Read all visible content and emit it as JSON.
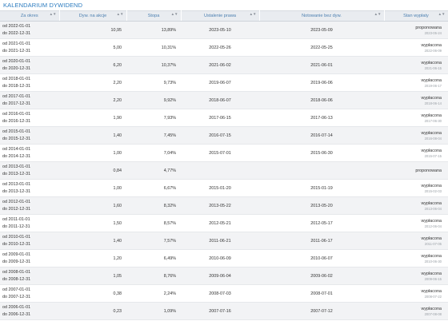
{
  "title": "KALENDARIUM DYWIDEND",
  "columns": [
    {
      "label": "Za okres"
    },
    {
      "label": "Dyw. na akcje"
    },
    {
      "label": "Stopa"
    },
    {
      "label": "Ustalenie prawa"
    },
    {
      "label": "Notowanie bez dyw."
    },
    {
      "label": "Stan wypłaty"
    }
  ],
  "sort_glyph": "▲▼",
  "rows": [
    {
      "from": "od 2022-01-01",
      "to": "do 2022-12-31",
      "dividend": "10,95",
      "yield": "13,89%",
      "record": "2023-05-10",
      "exdiv": "2023-05-09",
      "status": "proponowana",
      "status_date": "2023-05-24"
    },
    {
      "from": "od 2021-01-01",
      "to": "do 2021-12-31",
      "dividend": "5,00",
      "yield": "10,31%",
      "record": "2022-05-26",
      "exdiv": "2022-05-25",
      "status": "wypłacona",
      "status_date": "2022-06-09"
    },
    {
      "from": "od 2020-01-01",
      "to": "do 2020-12-31",
      "dividend": "6,20",
      "yield": "10,37%",
      "record": "2021-06-02",
      "exdiv": "2021-06-01",
      "status": "wypłacona",
      "status_date": "2021-06-15"
    },
    {
      "from": "od 2018-01-01",
      "to": "do 2018-12-31",
      "dividend": "2,20",
      "yield": "9,73%",
      "record": "2019-06-07",
      "exdiv": "2019-06-06",
      "status": "wypłacona",
      "status_date": "2019-06-17"
    },
    {
      "from": "od 2017-01-01",
      "to": "do 2017-12-31",
      "dividend": "2,20",
      "yield": "9,92%",
      "record": "2018-06-07",
      "exdiv": "2018-06-06",
      "status": "wypłacona",
      "status_date": "2018-06-14"
    },
    {
      "from": "od 2016-01-01",
      "to": "do 2016-12-31",
      "dividend": "1,90",
      "yield": "7,93%",
      "record": "2017-06-15",
      "exdiv": "2017-06-13",
      "status": "wypłacona",
      "status_date": "2017-06-30"
    },
    {
      "from": "od 2015-01-01",
      "to": "do 2015-12-31",
      "dividend": "1,40",
      "yield": "7,45%",
      "record": "2016-07-15",
      "exdiv": "2016-07-14",
      "status": "wypłacona",
      "status_date": "2016-08-04"
    },
    {
      "from": "od 2014-01-01",
      "to": "do 2014-12-31",
      "dividend": "1,00",
      "yield": "7,04%",
      "record": "2015-07-01",
      "exdiv": "2015-06-30",
      "status": "wypłacona",
      "status_date": "2015-07-15"
    },
    {
      "from": "od 2013-01-01",
      "to": "do 2013-12-31",
      "dividend": "0,84",
      "yield": "4,77%",
      "record": "",
      "exdiv": "",
      "status": "proponowana",
      "status_date": ""
    },
    {
      "from": "od 2013-01-01",
      "to": "do 2013-12-31",
      "dividend": "1,00",
      "yield": "6,67%",
      "record": "2015-01-20",
      "exdiv": "2015-01-19",
      "status": "wypłacona",
      "status_date": "2015-02-03"
    },
    {
      "from": "od 2012-01-01",
      "to": "do 2012-12-31",
      "dividend": "1,60",
      "yield": "8,32%",
      "record": "2013-05-22",
      "exdiv": "2013-05-20",
      "status": "wypłacona",
      "status_date": "2013-06-04"
    },
    {
      "from": "od 2011-01-01",
      "to": "do 2011-12-31",
      "dividend": "1,50",
      "yield": "8,57%",
      "record": "2012-05-21",
      "exdiv": "2012-05-17",
      "status": "wypłacona",
      "status_date": "2012-06-04"
    },
    {
      "from": "od 2010-01-01",
      "to": "do 2010-12-31",
      "dividend": "1,40",
      "yield": "7,57%",
      "record": "2011-06-21",
      "exdiv": "2011-06-17",
      "status": "wypłacona",
      "status_date": "2011-07-05"
    },
    {
      "from": "od 2009-01-01",
      "to": "do 2009-12-31",
      "dividend": "1,20",
      "yield": "6,49%",
      "record": "2010-06-09",
      "exdiv": "2010-06-07",
      "status": "wypłacona",
      "status_date": "2010-06-30"
    },
    {
      "from": "od 2008-01-01",
      "to": "do 2008-12-31",
      "dividend": "1,05",
      "yield": "8,76%",
      "record": "2009-06-04",
      "exdiv": "2009-06-02",
      "status": "wypłacona",
      "status_date": "2009-06-15"
    },
    {
      "from": "od 2007-01-01",
      "to": "do 2007-12-31",
      "dividend": "0,38",
      "yield": "2,24%",
      "record": "2008-07-03",
      "exdiv": "2008-07-01",
      "status": "wypłacona",
      "status_date": "2008-07-22"
    },
    {
      "from": "od 2006-01-01",
      "to": "do 2006-12-31",
      "dividend": "0,23",
      "yield": "1,09%",
      "record": "2007-07-16",
      "exdiv": "2007-07-12",
      "status": "wypłacona",
      "status_date": "2007-08-08"
    }
  ]
}
